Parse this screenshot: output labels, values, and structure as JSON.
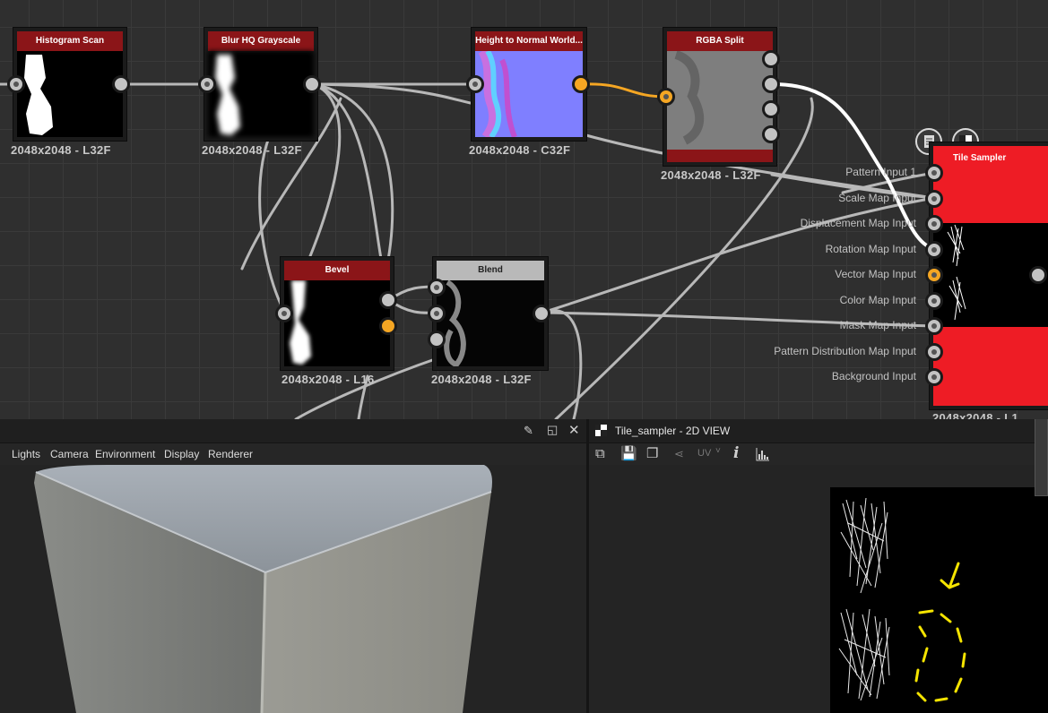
{
  "graph": {
    "nodes": {
      "histogram_scan": {
        "title": "Histogram Scan",
        "resolution": "2048x2048 - L32F"
      },
      "blur_hq": {
        "title": "Blur HQ Grayscale",
        "resolution": "2048x2048 - L32F"
      },
      "height_to_normal": {
        "title": "Height to Normal World...",
        "resolution": "2048x2048 - C32F"
      },
      "rgba_split": {
        "title": "RGBA Split",
        "resolution": "2048x2048 - L32F"
      },
      "bevel": {
        "title": "Bevel",
        "resolution": "2048x2048 - L16"
      },
      "blend": {
        "title": "Blend",
        "resolution": "2048x2048 - L32F"
      },
      "tile_sampler": {
        "title": "Tile Sampler",
        "resolution": "2048x2048 - L1",
        "inputs": [
          "Pattern Input 1",
          "Scale Map Input",
          "Displacement Map Input",
          "Rotation Map Input",
          "Vector Map Input",
          "Color Map Input",
          "Mask Map Input",
          "Pattern Distribution Map Input",
          "Background Input"
        ]
      }
    },
    "colors": {
      "header": "#8b1518",
      "port": "#c3c3c3",
      "port_active": "#f5a623",
      "tile_red": "#ee1c25"
    }
  },
  "viewport3d": {
    "menu": [
      "Lights",
      "Camera",
      "Environment",
      "Display",
      "Renderer"
    ]
  },
  "view2d": {
    "title": "Tile_sampler - 2D VIEW",
    "toolbar": {
      "uv_label": "UV",
      "info_glyph": "i"
    }
  }
}
